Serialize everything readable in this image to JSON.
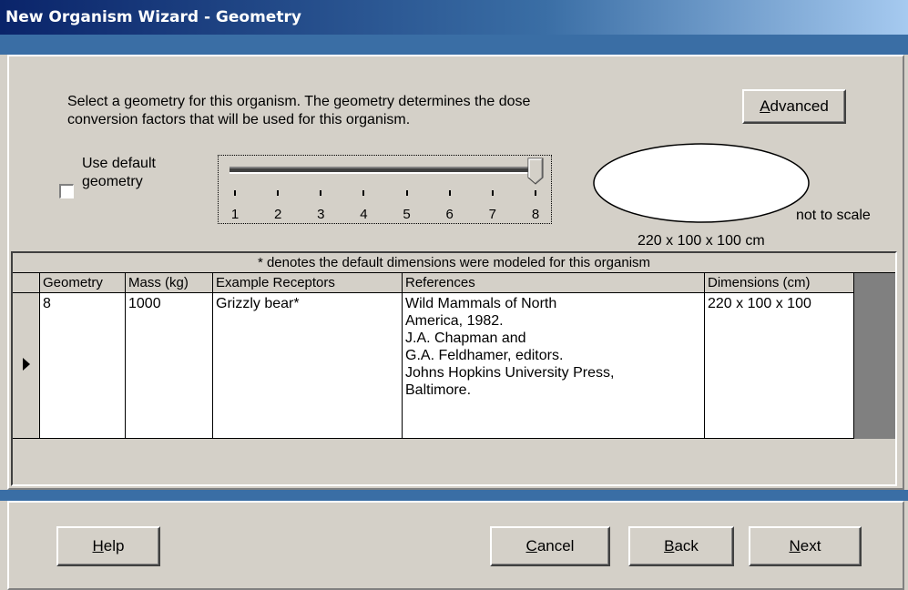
{
  "window": {
    "title": "New Organism Wizard - Geometry"
  },
  "intro": {
    "line1": "Select a geometry for this organism.  The geometry determines the dose",
    "line2": "conversion factors that will be used for this organism."
  },
  "advanced_button": {
    "pre": "",
    "mnemonic": "A",
    "post": "dvanced"
  },
  "default_geometry": {
    "label_line1": "Use default",
    "label_line2": "geometry",
    "checked": false
  },
  "slider": {
    "ticks": [
      "1",
      "2",
      "3",
      "4",
      "5",
      "6",
      "7",
      "8"
    ],
    "value": 8,
    "min": 1,
    "max": 8
  },
  "shape_preview": {
    "scale_note": "not to scale",
    "dimensions": "220 x 100 x 100 cm"
  },
  "table": {
    "caption": "* denotes the default dimensions were modeled for this organism",
    "columns": [
      "Geometry",
      "Mass (kg)",
      "Example Receptors",
      "References",
      "Dimensions (cm)"
    ],
    "rows": [
      {
        "geometry": "8",
        "mass": "1000",
        "receptors": "Grizzly bear*",
        "references": [
          "Wild Mammals of North",
          "America, 1982.",
          "J.A. Chapman and",
          "G.A. Feldhamer, editors.",
          "Johns Hopkins University Press,",
          "Baltimore."
        ],
        "dimensions": "220 x 100 x 100"
      }
    ]
  },
  "buttons": {
    "help": {
      "pre": "",
      "mnemonic": "H",
      "post": "elp"
    },
    "cancel": {
      "pre": "",
      "mnemonic": "C",
      "post": "ancel"
    },
    "back": {
      "pre": "",
      "mnemonic": "B",
      "post": "ack"
    },
    "next": {
      "pre": "",
      "mnemonic": "N",
      "post": "ext"
    }
  },
  "colors": {
    "face": "#d4d0c8",
    "title_start": "#0a246a",
    "title_end": "#a6caf0",
    "desktop_blue": "#3a6ea5"
  }
}
